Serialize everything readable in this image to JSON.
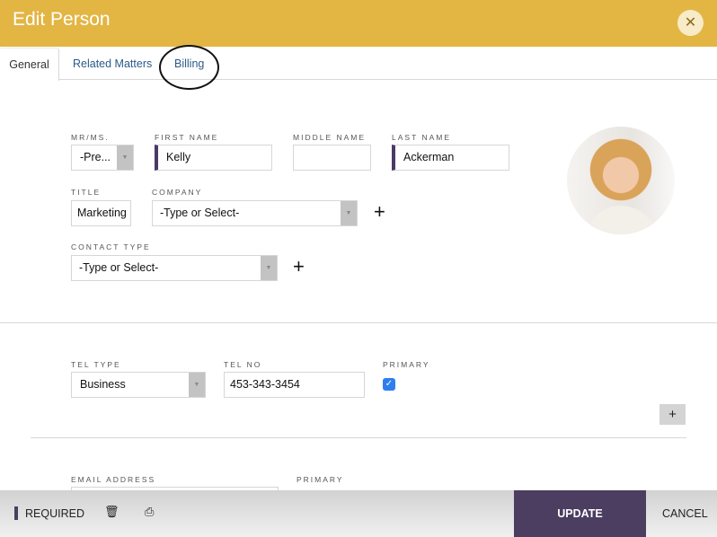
{
  "dialog": {
    "title": "Edit Person"
  },
  "tabs": [
    {
      "label": "General"
    },
    {
      "label": "Related Matters"
    },
    {
      "label": "Billing"
    }
  ],
  "form": {
    "salutation": {
      "label": "MR/MS.",
      "value": "-Pre..."
    },
    "first_name": {
      "label": "FIRST NAME",
      "value": "Kelly"
    },
    "middle_name": {
      "label": "MIDDLE NAME",
      "value": ""
    },
    "last_name": {
      "label": "LAST NAME",
      "value": "Ackerman"
    },
    "title": {
      "label": "TITLE",
      "value": "Marketing S"
    },
    "company": {
      "label": "COMPANY",
      "value": "-Type or Select-"
    },
    "contact_type": {
      "label": "CONTACT TYPE",
      "value": "-Type or Select-"
    },
    "tel_type": {
      "label": "TEL TYPE",
      "value": "Business"
    },
    "tel_no": {
      "label": "TEL NO",
      "value": "453-343-3454"
    },
    "tel_primary": {
      "label": "PRIMARY",
      "checked": true
    },
    "email": {
      "label": "EMAIL ADDRESS",
      "value": ""
    },
    "email_primary": {
      "label": "PRIMARY"
    }
  },
  "footer": {
    "required": "REQUIRED",
    "update": "UPDATE",
    "cancel": "CANCEL"
  },
  "colors": {
    "header": "#e3b543",
    "accent": "#4b3e60",
    "checkbox": "#2f7ef0"
  }
}
